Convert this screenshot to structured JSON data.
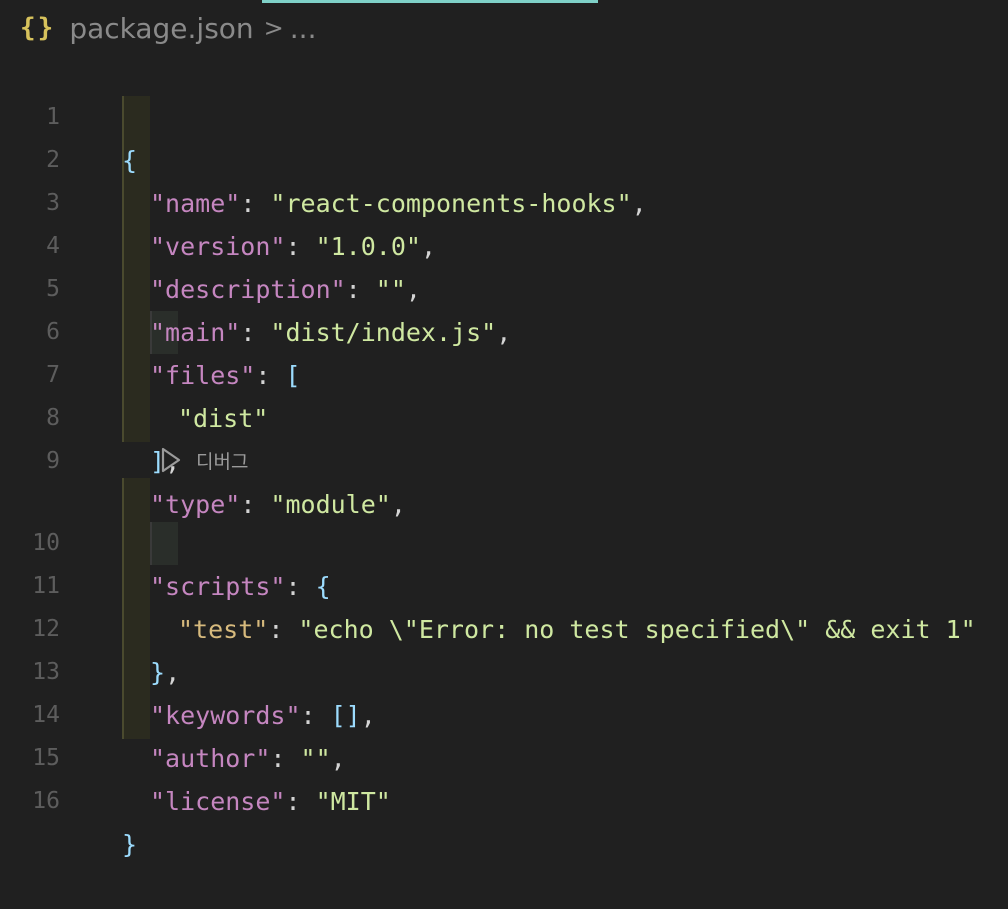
{
  "breadcrumb": {
    "icon": "{}",
    "file": "package.json",
    "separator": ">",
    "more": "..."
  },
  "codelens": {
    "label": "디버그"
  },
  "lines": [
    {
      "n": "1"
    },
    {
      "n": "2"
    },
    {
      "n": "3"
    },
    {
      "n": "4"
    },
    {
      "n": "5"
    },
    {
      "n": "6"
    },
    {
      "n": "7"
    },
    {
      "n": "8"
    },
    {
      "n": "9"
    },
    {
      "n": "10"
    },
    {
      "n": "11"
    },
    {
      "n": "12"
    },
    {
      "n": "13"
    },
    {
      "n": "14"
    },
    {
      "n": "15"
    },
    {
      "n": "16"
    }
  ],
  "json": {
    "name_key": "\"name\"",
    "name_val": "\"react-components-hooks\"",
    "version_key": "\"version\"",
    "version_val": "\"1.0.0\"",
    "description_key": "\"description\"",
    "description_val": "\"\"",
    "main_key": "\"main\"",
    "main_val": "\"dist/index.js\"",
    "files_key": "\"files\"",
    "files_item": "\"dist\"",
    "type_key": "\"type\"",
    "type_val": "\"module\"",
    "scripts_key": "\"scripts\"",
    "test_key": "\"test\"",
    "test_val": "\"echo \\\"Error: no test specified\\\" && exit 1\"",
    "keywords_key": "\"keywords\"",
    "keywords_val": "[]",
    "author_key": "\"author\"",
    "author_val": "\"\"",
    "license_key": "\"license\"",
    "license_val": "\"MIT\""
  },
  "colors": {
    "background": "#202020",
    "key": "#c586c0",
    "string": "#cfe8a1",
    "bracket": "#9cdcfe",
    "line_number": "#5d5d5d"
  }
}
